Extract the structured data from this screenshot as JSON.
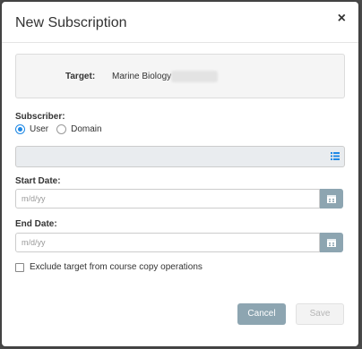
{
  "dialog": {
    "title": "New Subscription",
    "close_glyph": "×"
  },
  "target": {
    "label": "Target:",
    "value": "Marine Biology"
  },
  "subscriber": {
    "label": "Subscriber:",
    "options": [
      {
        "label": "User",
        "selected": true
      },
      {
        "label": "Domain",
        "selected": false
      }
    ],
    "value": ""
  },
  "start_date": {
    "label": "Start Date:",
    "placeholder": "m/d/yy"
  },
  "end_date": {
    "label": "End Date:",
    "placeholder": "m/d/yy"
  },
  "exclude": {
    "label": "Exclude target from course copy operations",
    "checked": false
  },
  "buttons": {
    "cancel": "Cancel",
    "save": "Save"
  },
  "colors": {
    "accent": "#1e88e5",
    "button_slate": "#8da5b1",
    "disabled_text": "#b5b5b5"
  }
}
